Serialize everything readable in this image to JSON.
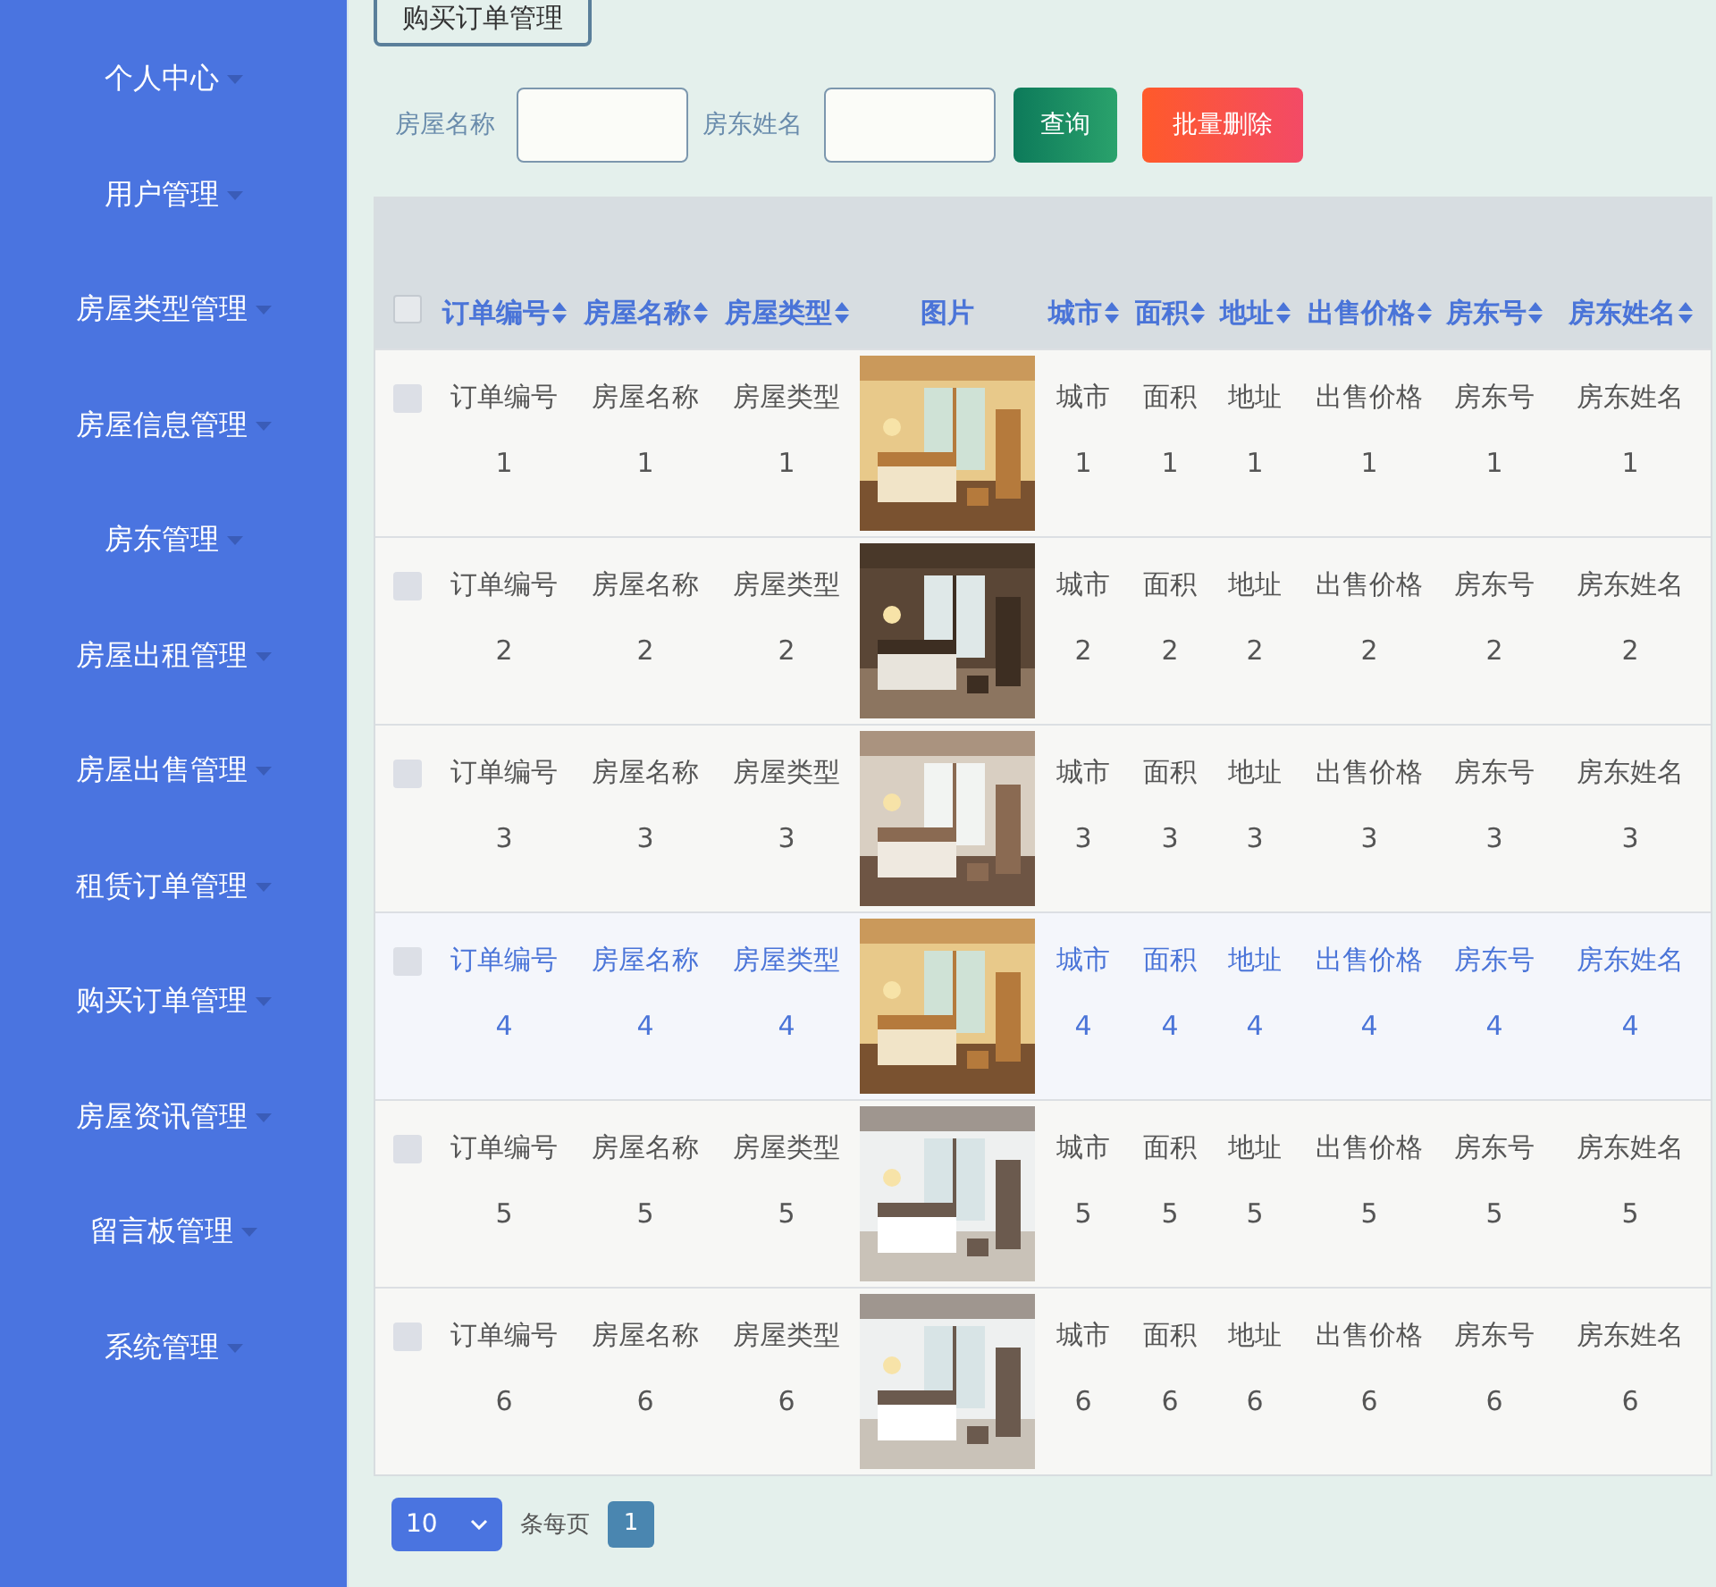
{
  "breadcrumb_button": "购买订单管理",
  "sidebar": {
    "items": [
      {
        "label": "个人中心"
      },
      {
        "label": "用户管理"
      },
      {
        "label": "房屋类型管理"
      },
      {
        "label": "房屋信息管理"
      },
      {
        "label": "房东管理"
      },
      {
        "label": "房屋出租管理"
      },
      {
        "label": "房屋出售管理"
      },
      {
        "label": "租赁订单管理"
      },
      {
        "label": "购买订单管理"
      },
      {
        "label": "房屋资讯管理"
      },
      {
        "label": "留言板管理"
      },
      {
        "label": "系统管理"
      }
    ]
  },
  "search": {
    "fields": [
      {
        "label": "房屋名称"
      },
      {
        "label": "房东姓名"
      }
    ],
    "buttons": [
      {
        "label": "查询",
        "kind": "query"
      },
      {
        "label": "批量删除",
        "kind": "delete"
      }
    ]
  },
  "table": {
    "select_all_checked": false,
    "columns": [
      {
        "label": "订单编号",
        "sortable": true
      },
      {
        "label": "房屋名称",
        "sortable": true
      },
      {
        "label": "房屋类型",
        "sortable": true
      },
      {
        "label": "图片",
        "sortable": false
      },
      {
        "label": "城市",
        "sortable": true
      },
      {
        "label": "面积",
        "sortable": true
      },
      {
        "label": "地址",
        "sortable": true
      },
      {
        "label": "出售价格",
        "sortable": true
      },
      {
        "label": "房东号",
        "sortable": true
      },
      {
        "label": "房东姓名",
        "sortable": true
      }
    ],
    "rows": [
      {
        "checked": false,
        "highlighted": false,
        "cells": [
          {
            "kind": "text",
            "label": "订单编号",
            "value": "1"
          },
          {
            "kind": "text",
            "label": "房屋名称",
            "value": "1"
          },
          {
            "kind": "text",
            "label": "房屋类型",
            "value": "1"
          },
          {
            "kind": "picture"
          },
          {
            "kind": "text",
            "label": "城市",
            "value": "1"
          },
          {
            "kind": "text",
            "label": "面积",
            "value": "1"
          },
          {
            "kind": "text",
            "label": "地址",
            "value": "1"
          },
          {
            "kind": "text",
            "label": "出售价格",
            "value": "1"
          },
          {
            "kind": "text",
            "label": "房东号",
            "value": "1"
          },
          {
            "kind": "text",
            "label": "房东姓名",
            "value": "1"
          }
        ]
      },
      {
        "checked": false,
        "highlighted": false,
        "cells": [
          {
            "kind": "text",
            "label": "订单编号",
            "value": "2"
          },
          {
            "kind": "text",
            "label": "房屋名称",
            "value": "2"
          },
          {
            "kind": "text",
            "label": "房屋类型",
            "value": "2"
          },
          {
            "kind": "picture"
          },
          {
            "kind": "text",
            "label": "城市",
            "value": "2"
          },
          {
            "kind": "text",
            "label": "面积",
            "value": "2"
          },
          {
            "kind": "text",
            "label": "地址",
            "value": "2"
          },
          {
            "kind": "text",
            "label": "出售价格",
            "value": "2"
          },
          {
            "kind": "text",
            "label": "房东号",
            "value": "2"
          },
          {
            "kind": "text",
            "label": "房东姓名",
            "value": "2"
          }
        ]
      },
      {
        "checked": false,
        "highlighted": false,
        "cells": [
          {
            "kind": "text",
            "label": "订单编号",
            "value": "3"
          },
          {
            "kind": "text",
            "label": "房屋名称",
            "value": "3"
          },
          {
            "kind": "text",
            "label": "房屋类型",
            "value": "3"
          },
          {
            "kind": "picture"
          },
          {
            "kind": "text",
            "label": "城市",
            "value": "3"
          },
          {
            "kind": "text",
            "label": "面积",
            "value": "3"
          },
          {
            "kind": "text",
            "label": "地址",
            "value": "3"
          },
          {
            "kind": "text",
            "label": "出售价格",
            "value": "3"
          },
          {
            "kind": "text",
            "label": "房东号",
            "value": "3"
          },
          {
            "kind": "text",
            "label": "房东姓名",
            "value": "3"
          }
        ]
      },
      {
        "checked": false,
        "highlighted": true,
        "cells": [
          {
            "kind": "text",
            "label": "订单编号",
            "value": "4"
          },
          {
            "kind": "text",
            "label": "房屋名称",
            "value": "4"
          },
          {
            "kind": "text",
            "label": "房屋类型",
            "value": "4"
          },
          {
            "kind": "picture"
          },
          {
            "kind": "text",
            "label": "城市",
            "value": "4"
          },
          {
            "kind": "text",
            "label": "面积",
            "value": "4"
          },
          {
            "kind": "text",
            "label": "地址",
            "value": "4"
          },
          {
            "kind": "text",
            "label": "出售价格",
            "value": "4"
          },
          {
            "kind": "text",
            "label": "房东号",
            "value": "4"
          },
          {
            "kind": "text",
            "label": "房东姓名",
            "value": "4"
          }
        ]
      },
      {
        "checked": false,
        "highlighted": false,
        "cells": [
          {
            "kind": "text",
            "label": "订单编号",
            "value": "5"
          },
          {
            "kind": "text",
            "label": "房屋名称",
            "value": "5"
          },
          {
            "kind": "text",
            "label": "房屋类型",
            "value": "5"
          },
          {
            "kind": "picture"
          },
          {
            "kind": "text",
            "label": "城市",
            "value": "5"
          },
          {
            "kind": "text",
            "label": "面积",
            "value": "5"
          },
          {
            "kind": "text",
            "label": "地址",
            "value": "5"
          },
          {
            "kind": "text",
            "label": "出售价格",
            "value": "5"
          },
          {
            "kind": "text",
            "label": "房东号",
            "value": "5"
          },
          {
            "kind": "text",
            "label": "房东姓名",
            "value": "5"
          }
        ]
      },
      {
        "checked": false,
        "highlighted": false,
        "cells": [
          {
            "kind": "text",
            "label": "订单编号",
            "value": "6"
          },
          {
            "kind": "text",
            "label": "房屋名称",
            "value": "6"
          },
          {
            "kind": "text",
            "label": "房屋类型",
            "value": "6"
          },
          {
            "kind": "picture"
          },
          {
            "kind": "text",
            "label": "城市",
            "value": "6"
          },
          {
            "kind": "text",
            "label": "面积",
            "value": "6"
          },
          {
            "kind": "text",
            "label": "地址",
            "value": "6"
          },
          {
            "kind": "text",
            "label": "出售价格",
            "value": "6"
          },
          {
            "kind": "text",
            "label": "房东号",
            "value": "6"
          },
          {
            "kind": "text",
            "label": "房东姓名",
            "value": "6"
          }
        ]
      }
    ]
  },
  "pagination": {
    "page_size": "10",
    "page_size_label": "条每页",
    "pages": [
      {
        "label": "1",
        "selected": true
      }
    ]
  }
}
